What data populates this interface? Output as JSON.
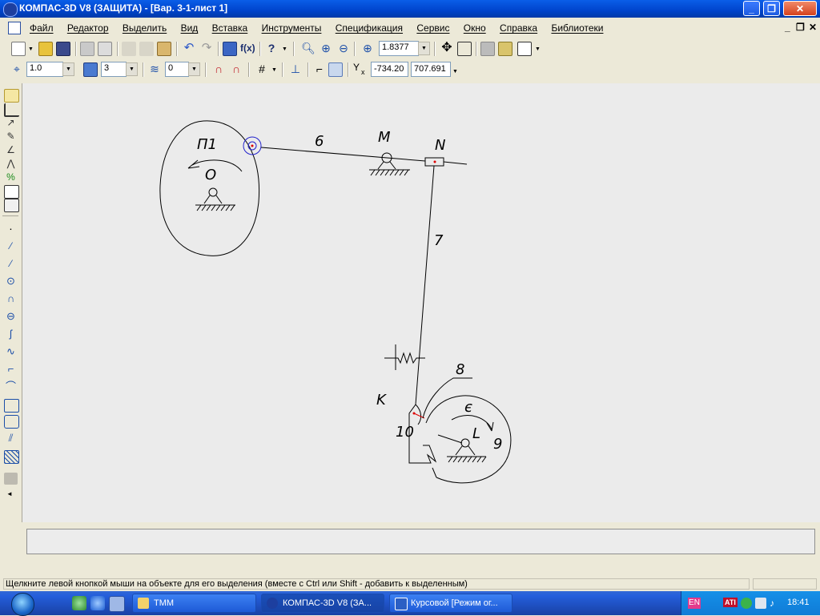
{
  "window": {
    "title": "КОМПАС-3D V8 (ЗАЩИТА) - [Вар. 3-1-лист 1]"
  },
  "menu": [
    "Файл",
    "Редактор",
    "Выделить",
    "Вид",
    "Вставка",
    "Инструменты",
    "Спецификация",
    "Сервис",
    "Окно",
    "Справка",
    "Библиотеки"
  ],
  "toolbar1": {
    "zoom": "1.8377"
  },
  "toolbar2": {
    "scale": "1.0",
    "layer_style": "3",
    "layer": "0",
    "coord_x": "-734.20",
    "coord_y": "707.691",
    "axis_label_y": "Y",
    "axis_label_x": "x"
  },
  "drawing": {
    "labels": {
      "p1": "П1",
      "o": "O",
      "six": "6",
      "m": "M",
      "n": "N",
      "seven": "7",
      "eight": "8",
      "k": "K",
      "ten": "10",
      "epsilon": "є",
      "l": "L",
      "nine": "9"
    }
  },
  "status": {
    "message": "Щелкните левой кнопкой мыши на объекте для его выделения (вместе с Ctrl или Shift - добавить к выделенным)"
  },
  "taskbar": {
    "tasks": [
      {
        "label": "ТММ"
      },
      {
        "label": "КОМПАС-3D V8 (ЗА..."
      },
      {
        "label": "Курсовой [Режим ог..."
      }
    ],
    "lang": "EN",
    "ati": "ATI",
    "clock": "18:41"
  },
  "colors": {
    "titlebar": "#0054e3",
    "canvas": "#ebebeb",
    "taskbar": "#245edb",
    "selection": "#2222cc",
    "point": "#dd0000"
  }
}
